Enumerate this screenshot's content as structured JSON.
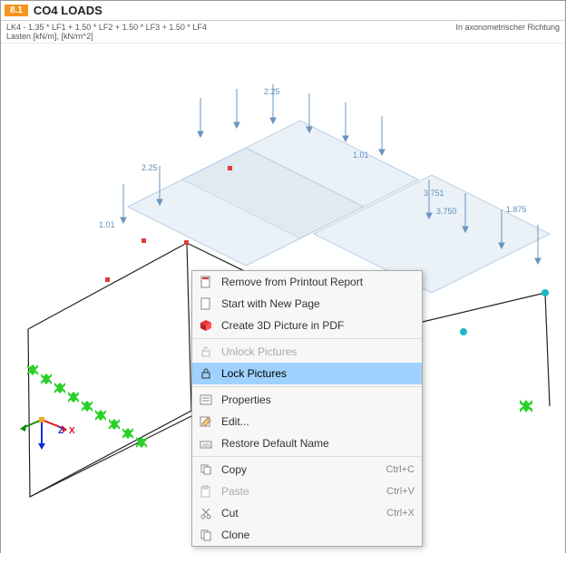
{
  "header": {
    "badge": "8.1",
    "title": "CO4 LOADS"
  },
  "subheader": {
    "left_line1": "LK4 - 1.35 * LF1 + 1.50 * LF2 + 1.50 * LF3 + 1.50 * LF4",
    "left_line2": "Lasten [kN/m], [kN/m^2]",
    "right": "In axonometrischer Richtung"
  },
  "labels": {
    "v1": "2.25",
    "v2": "1.01",
    "v3": "2.25",
    "v4": "1.01",
    "v5": "3.751",
    "v6": "3.750",
    "v7": "1.875"
  },
  "axis": {
    "x": "X",
    "z": "Z",
    "small_z": "Z"
  },
  "menu": {
    "remove": "Remove from Printout Report",
    "startnew": "Start with New Page",
    "create3d": "Create 3D Picture in PDF",
    "unlock": "Unlock Pictures",
    "lock": "Lock Pictures",
    "properties": "Properties",
    "edit": "Edit...",
    "restore": "Restore Default Name",
    "copy": "Copy",
    "copy_sc": "Ctrl+C",
    "paste": "Paste",
    "paste_sc": "Ctrl+V",
    "cut": "Cut",
    "cut_sc": "Ctrl+X",
    "clone": "Clone"
  }
}
